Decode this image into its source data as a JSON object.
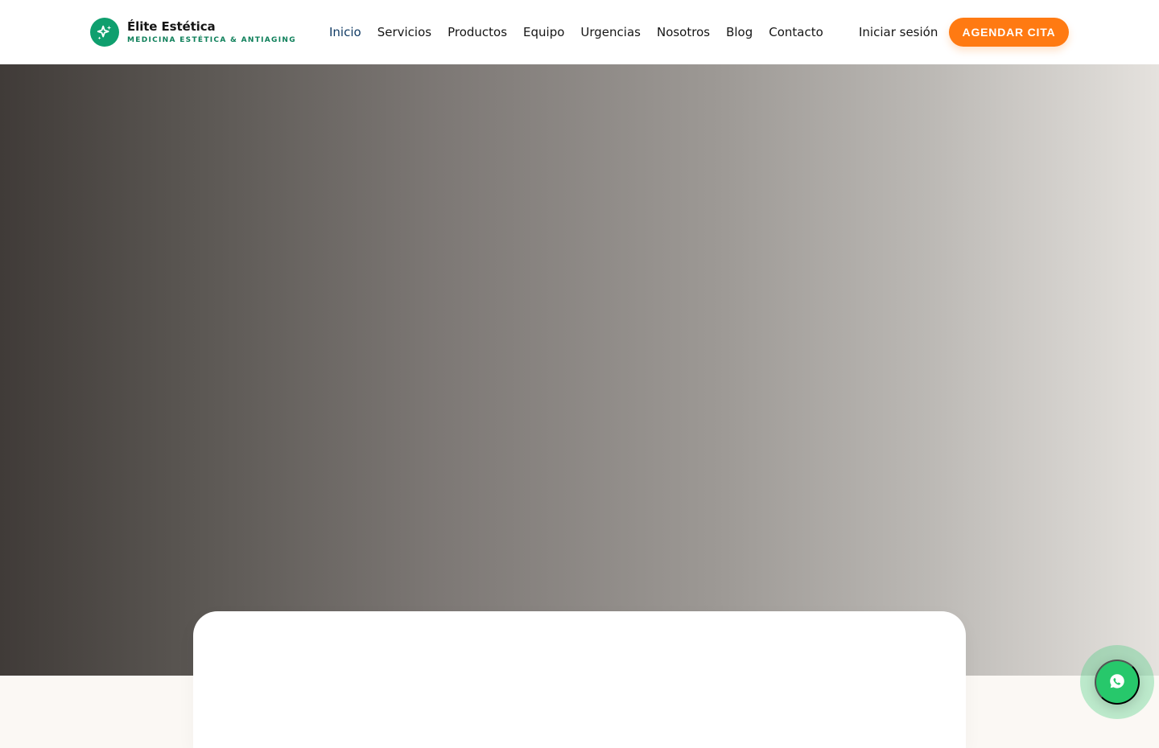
{
  "header": {
    "brand": {
      "name": "Élite Estética",
      "tagline": "MEDICINA ESTÉTICA & ANTIAGING",
      "icon": "sparkle-icon"
    },
    "nav": [
      {
        "label": "Inicio",
        "active": true
      },
      {
        "label": "Servicios",
        "active": false
      },
      {
        "label": "Productos",
        "active": false
      },
      {
        "label": "Equipo",
        "active": false
      },
      {
        "label": "Urgencias",
        "active": false
      },
      {
        "label": "Nosotros",
        "active": false
      },
      {
        "label": "Blog",
        "active": false
      },
      {
        "label": "Contacto",
        "active": false
      }
    ],
    "login_label": "Iniciar sesión",
    "cta_label": "AGENDAR CITA"
  },
  "floating_action": {
    "icon": "whatsapp-icon"
  },
  "colors": {
    "brand_green": "#0f9f6e",
    "accent_orange": "#ff7a12",
    "active_nav": "#123c65",
    "whatsapp_green": "#27c86b",
    "page_background": "#fbf8f4"
  }
}
